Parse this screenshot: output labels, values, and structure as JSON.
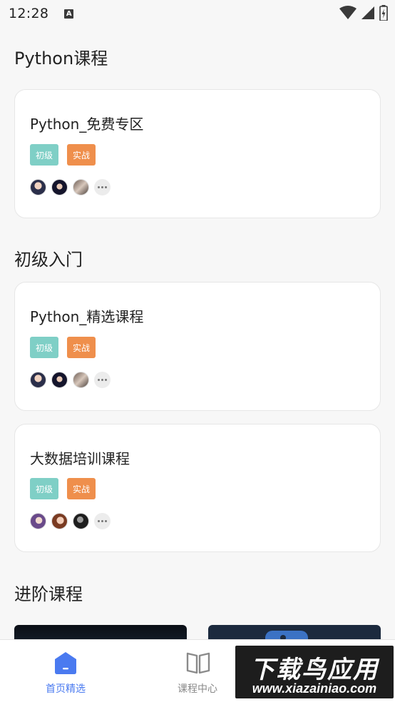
{
  "status_bar": {
    "time": "12:28",
    "notification_letter": "A"
  },
  "sections": [
    {
      "title": "Python课程",
      "cards": [
        {
          "title": "Python_免费专区",
          "tags": [
            "初级",
            "实战"
          ]
        }
      ]
    },
    {
      "title": "初级入门",
      "cards": [
        {
          "title": "Python_精选课程",
          "tags": [
            "初级",
            "实战"
          ]
        },
        {
          "title": "大数据培训课程",
          "tags": [
            "初级",
            "实战"
          ]
        }
      ]
    },
    {
      "title": "进阶课程",
      "cards": []
    }
  ],
  "tabbar": {
    "tabs": [
      {
        "label": "首页精选",
        "icon": "home-icon",
        "active": true
      },
      {
        "label": "课程中心",
        "icon": "book-icon",
        "active": false
      },
      {
        "label": "",
        "icon": "user-icon",
        "active": false
      }
    ]
  },
  "watermark": {
    "line1": "下载鸟应用",
    "line2": "www.xiazainiao.com"
  },
  "colors": {
    "accent": "#4a7af0",
    "tag_level": "#7fcfc6",
    "tag_practice": "#ef8f4c",
    "background": "#f7f7f7"
  }
}
